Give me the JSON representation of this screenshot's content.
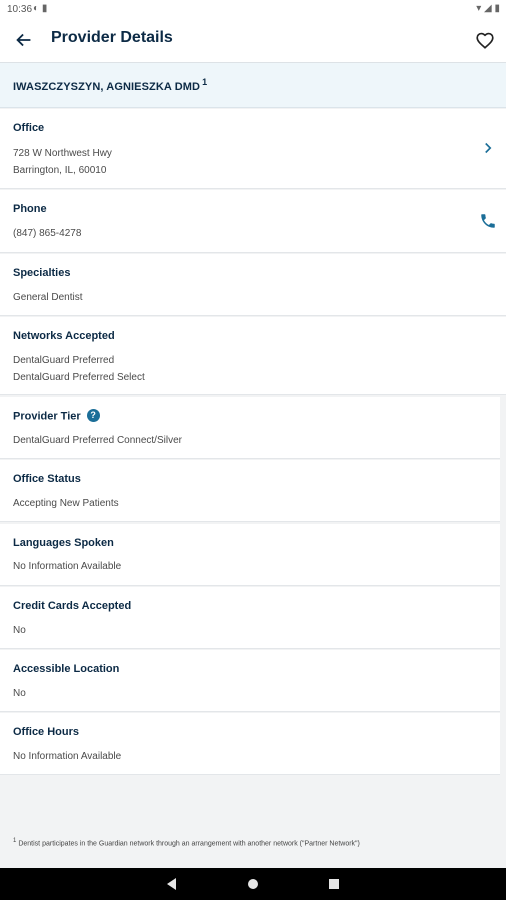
{
  "status_bar": {
    "time": "10:36"
  },
  "header": {
    "title": "Provider Details"
  },
  "provider": {
    "name": "IWASZCZYSZYN, AGNIESZKA DMD",
    "footnote_marker": "1"
  },
  "sections": {
    "office": {
      "label": "Office",
      "address_line1": "728 W Northwest Hwy",
      "address_line2": "Barrington, IL, 60010"
    },
    "phone": {
      "label": "Phone",
      "value": "(847) 865-4278"
    },
    "specialties": {
      "label": "Specialties",
      "value": "General Dentist"
    },
    "networks": {
      "label": "Networks Accepted",
      "values": [
        "DentalGuard Preferred",
        "DentalGuard Preferred Select"
      ]
    },
    "tier": {
      "label": "Provider Tier",
      "help": "?",
      "value": "DentalGuard Preferred Connect/Silver"
    },
    "office_status": {
      "label": "Office Status",
      "value": "Accepting New Patients"
    },
    "languages": {
      "label": "Languages Spoken",
      "value": "No Information Available"
    },
    "credit_cards": {
      "label": "Credit Cards Accepted",
      "value": "No"
    },
    "accessible": {
      "label": "Accessible Location",
      "value": "No"
    },
    "hours": {
      "label": "Office Hours",
      "value": "No Information Available"
    }
  },
  "footnote": {
    "marker": "1",
    "text": "Dentist participates in the Guardian network through an arrangement with another network (\"Partner Network\")"
  },
  "icons": {
    "back": "arrow-left-icon",
    "favorite": "heart-outline-icon",
    "chevron": "chevron-right-icon",
    "phone": "phone-icon",
    "help": "help-circle-icon"
  },
  "colors": {
    "accent": "#1b6e98",
    "title": "#0c2a45",
    "name_band": "#eef6fa"
  }
}
